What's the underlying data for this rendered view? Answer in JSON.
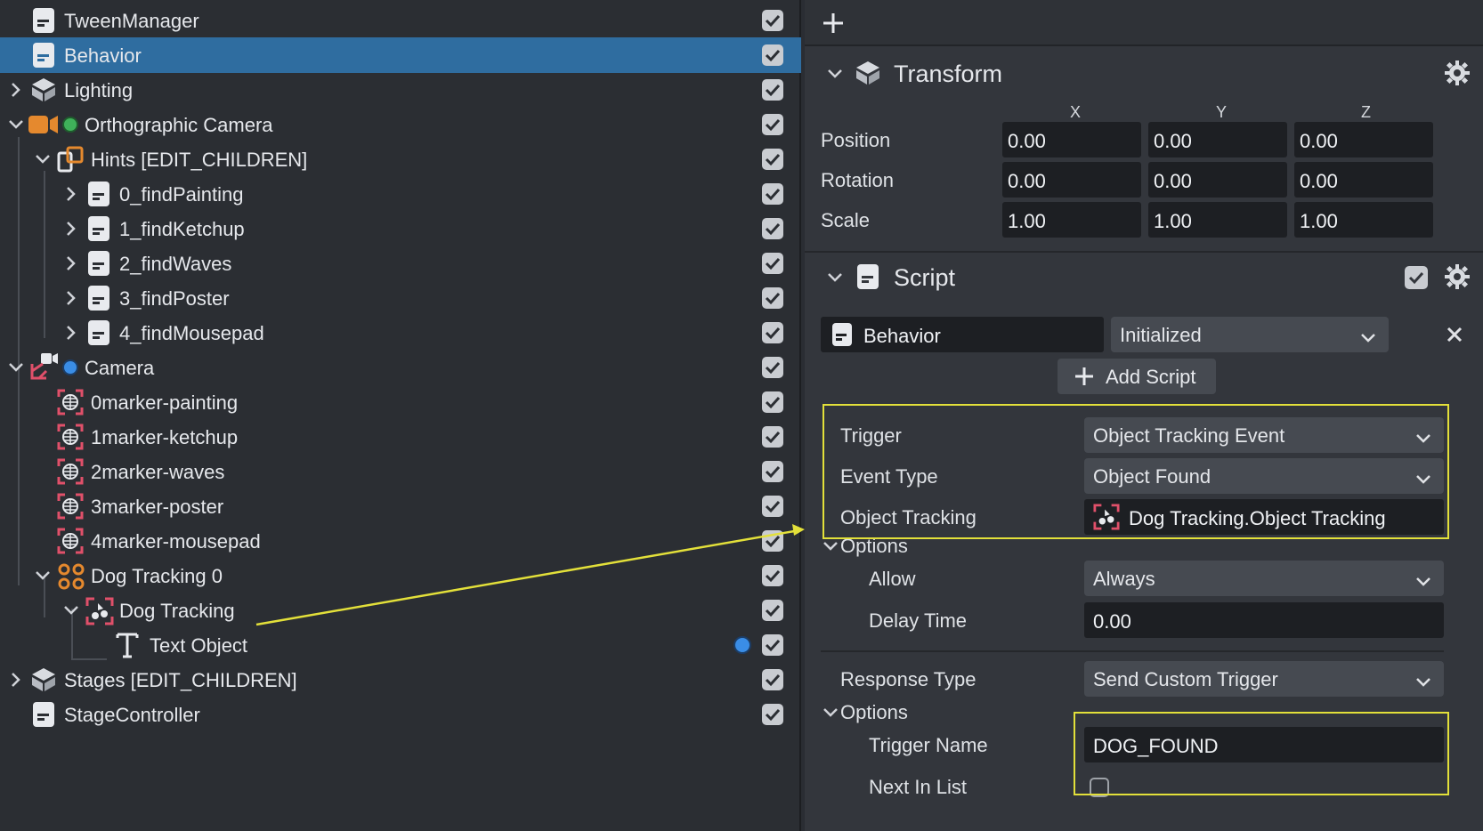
{
  "hierarchy": {
    "items": [
      {
        "label": "TweenManager"
      },
      {
        "label": "Behavior"
      },
      {
        "label": "Lighting"
      },
      {
        "label": "Orthographic Camera"
      },
      {
        "label": "Hints [EDIT_CHILDREN]"
      },
      {
        "label": "0_findPainting"
      },
      {
        "label": "1_findKetchup"
      },
      {
        "label": "2_findWaves"
      },
      {
        "label": "3_findPoster"
      },
      {
        "label": "4_findMousepad"
      },
      {
        "label": "Camera"
      },
      {
        "label": "0marker-painting"
      },
      {
        "label": "1marker-ketchup"
      },
      {
        "label": "2marker-waves"
      },
      {
        "label": "3marker-poster"
      },
      {
        "label": "4marker-mousepad"
      },
      {
        "label": "Dog Tracking 0"
      },
      {
        "label": "Dog Tracking"
      },
      {
        "label": "Text Object"
      },
      {
        "label": "Stages [EDIT_CHILDREN]"
      },
      {
        "label": "StageController"
      }
    ]
  },
  "inspector": {
    "transform": {
      "title": "Transform",
      "axes": [
        "X",
        "Y",
        "Z"
      ],
      "rows": [
        {
          "label": "Position",
          "values": [
            "0.00",
            "0.00",
            "0.00"
          ]
        },
        {
          "label": "Rotation",
          "values": [
            "0.00",
            "0.00",
            "0.00"
          ]
        },
        {
          "label": "Scale",
          "values": [
            "1.00",
            "1.00",
            "1.00"
          ]
        }
      ]
    },
    "script": {
      "title": "Script",
      "script_name": "Behavior",
      "state": "Initialized",
      "add_script_label": "Add Script",
      "trigger_label": "Trigger",
      "trigger_value": "Object Tracking Event",
      "event_type_label": "Event Type",
      "event_type_value": "Object Found",
      "object_tracking_label": "Object Tracking",
      "object_tracking_value": "Dog Tracking.Object Tracking",
      "options_label": "Options",
      "allow_label": "Allow",
      "allow_value": "Always",
      "delay_label": "Delay Time",
      "delay_value": "0.00",
      "response_type_label": "Response Type",
      "response_type_value": "Send Custom Trigger",
      "options2_label": "Options",
      "trigger_name_label": "Trigger Name",
      "trigger_name_value": "DOG_FOUND",
      "next_in_list_label": "Next In List"
    }
  },
  "colors": {
    "selection": "#2f6da0",
    "highlight": "#e3e03a",
    "marker_red": "#e0506a",
    "camera_orange": "#e5892e",
    "green_dot": "#3fb15a",
    "blue_dot": "#3a8de6"
  }
}
